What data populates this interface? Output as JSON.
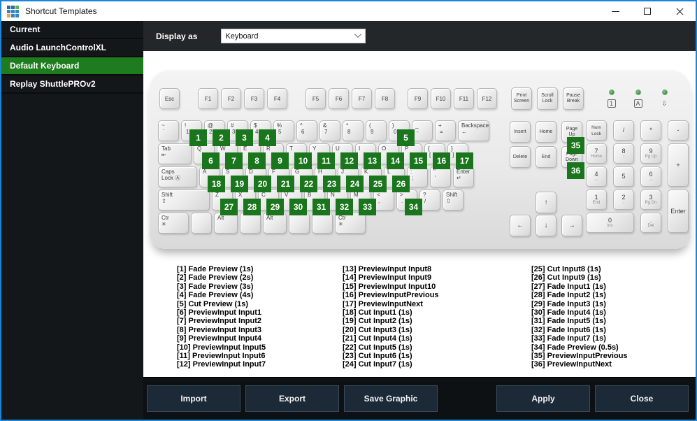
{
  "colors": {
    "accent_green": "#1e7c1f",
    "badge_green": "#1a761c",
    "window_border": "#1985dc"
  },
  "window": {
    "title": "Shortcut Templates",
    "icon_colors": [
      "#33689b",
      "#33689b",
      "#52b84d",
      "#2e86c8",
      "#2e86c8",
      "#2e86c8",
      "#f2a33c",
      "#2e86c8",
      "#2e86c8"
    ]
  },
  "sidebar": {
    "items": [
      {
        "label": "Current",
        "selected": false
      },
      {
        "label": "Audio LaunchControlXL",
        "selected": false
      },
      {
        "label": "Default Keyboard",
        "selected": true
      },
      {
        "label": "Replay ShuttlePROv2",
        "selected": false
      }
    ]
  },
  "toolbar": {
    "label": "Display as",
    "dropdown_value": "Keyboard"
  },
  "keyboard": {
    "esc": "Esc",
    "function_groups": [
      [
        "F1",
        "F2",
        "F3",
        "F4"
      ],
      [
        "F5",
        "F6",
        "F7",
        "F8"
      ],
      [
        "F9",
        "F10",
        "F11",
        "F12"
      ]
    ],
    "function_group_lefts": [
      70,
      224,
      370
    ],
    "system_keys": [
      {
        "label": "Print\nScreen",
        "name": "print-screen"
      },
      {
        "label": "Scroll\nLock",
        "name": "scroll-lock"
      },
      {
        "label": "Pause\nBreak",
        "name": "pause-break"
      }
    ],
    "leds": [
      {
        "name": "num-lock-led",
        "glyph": "1",
        "boxed": true
      },
      {
        "name": "caps-lock-led",
        "glyph": "A",
        "boxed": true
      },
      {
        "name": "scroll-lock-led",
        "glyph": "⇩",
        "boxed": false
      }
    ],
    "main_rows": [
      {
        "keys": [
          {
            "top": "~",
            "bottom": "`"
          },
          {
            "top": "!",
            "bottom": "1",
            "badge": "1"
          },
          {
            "top": "@",
            "bottom": "2",
            "badge": "2"
          },
          {
            "top": "#",
            "bottom": "3",
            "badge": "3"
          },
          {
            "top": "$",
            "bottom": "4",
            "badge": "4"
          },
          {
            "top": "%",
            "bottom": "5"
          },
          {
            "top": "^",
            "bottom": "6"
          },
          {
            "top": "&",
            "bottom": "7"
          },
          {
            "top": "*",
            "bottom": "8"
          },
          {
            "top": "(",
            "bottom": "9"
          },
          {
            "top": ")",
            "bottom": "0",
            "badge": "5"
          },
          {
            "top": "_",
            "bottom": "-"
          },
          {
            "top": "+",
            "bottom": "="
          },
          {
            "label": "Backspace\n      ←",
            "fill": true,
            "name": "backspace"
          }
        ]
      },
      {
        "keys": [
          {
            "label": "Tab\n⇤",
            "w": 48,
            "name": "tab"
          },
          {
            "label": "Q",
            "badge": "6"
          },
          {
            "label": "W",
            "badge": "7"
          },
          {
            "label": "E",
            "badge": "8"
          },
          {
            "label": "R",
            "badge": "9"
          },
          {
            "label": "T",
            "badge": "10"
          },
          {
            "label": "Y",
            "badge": "11"
          },
          {
            "label": "U",
            "badge": "12"
          },
          {
            "label": "I",
            "badge": "13"
          },
          {
            "label": "O",
            "badge": "14"
          },
          {
            "label": "P",
            "badge": "15"
          },
          {
            "top": "{",
            "bottom": "[",
            "badge": "16",
            "name": "bracket-left"
          },
          {
            "top": "}",
            "bottom": "]",
            "badge": "17",
            "name": "bracket-right"
          }
        ]
      },
      {
        "keys": [
          {
            "label": "Caps\nLock Ⓐ",
            "w": 56,
            "name": "caps-lock"
          },
          {
            "label": "A",
            "badge": "18"
          },
          {
            "label": "S",
            "badge": "19"
          },
          {
            "label": "D",
            "badge": "20"
          },
          {
            "label": "F",
            "badge": "21"
          },
          {
            "label": "G",
            "badge": "22"
          },
          {
            "label": "H",
            "badge": "23"
          },
          {
            "label": "J",
            "badge": "24"
          },
          {
            "label": "K",
            "badge": "25"
          },
          {
            "label": "L",
            "badge": "26"
          },
          {
            "top": ":",
            "bottom": ";",
            "name": "semicolon"
          },
          {
            "top": "\"",
            "bottom": "'",
            "name": "quote"
          },
          {
            "label": "Enter ↵",
            "fill": true,
            "name": "enter"
          }
        ]
      },
      {
        "keys": [
          {
            "label": "Shift\n⇧",
            "w": 74,
            "name": "shift-left"
          },
          {
            "label": "Z",
            "badge": "27"
          },
          {
            "label": "X",
            "badge": "28"
          },
          {
            "label": "C",
            "badge": "29"
          },
          {
            "label": "V",
            "badge": "30"
          },
          {
            "label": "B",
            "badge": "31"
          },
          {
            "label": "N",
            "badge": "32"
          },
          {
            "label": "M",
            "badge": "33"
          },
          {
            "top": "<",
            "bottom": ",",
            "name": "comma"
          },
          {
            "top": ">",
            "bottom": ".",
            "badge": "34",
            "name": "period"
          },
          {
            "top": "?",
            "bottom": "/",
            "name": "slash"
          },
          {
            "label": "Shift\n⇧",
            "fill": true,
            "name": "shift-right"
          }
        ]
      },
      {
        "keys": [
          {
            "label": "Ctr\n✳",
            "w": 44,
            "name": "ctrl-left"
          },
          {
            "label": "",
            "w": 30,
            "name": "blank-left"
          },
          {
            "label": "Alt",
            "w": 34,
            "name": "alt-left"
          },
          {
            "label": "",
            "fill": true,
            "name": "space"
          },
          {
            "label": "Alt",
            "w": 34,
            "name": "alt-right"
          },
          {
            "label": "",
            "w": 30,
            "name": "blank-right-1"
          },
          {
            "label": "",
            "w": 30,
            "name": "blank-right-2"
          },
          {
            "label": "Ctr\n✳",
            "w": 44,
            "name": "ctrl-right"
          }
        ]
      }
    ],
    "nav_rows": [
      [
        {
          "label": "Insert"
        },
        {
          "label": "Home"
        },
        {
          "label": "Page\nUp",
          "badge": "35",
          "name": "page-up"
        }
      ],
      [
        {
          "label": "Delete"
        },
        {
          "label": "End"
        },
        {
          "label": "Page\nDown",
          "badge": "36",
          "name": "page-down"
        }
      ]
    ],
    "arrow_up": "↑",
    "arrow_bottom": [
      "←",
      "↓",
      "→"
    ],
    "arrow_names": [
      "arrow-left",
      "arrow-down",
      "arrow-right"
    ],
    "numpad": [
      {
        "label": "Num\nLock",
        "c": 1,
        "r": 1,
        "name": "num-lock",
        "small": true
      },
      {
        "label": "/",
        "c": 2,
        "r": 1,
        "name": "numpad-divide"
      },
      {
        "label": "*",
        "c": 3,
        "r": 1,
        "name": "numpad-multiply"
      },
      {
        "label": "-",
        "c": 4,
        "r": 1,
        "name": "numpad-minus"
      },
      {
        "top": "7",
        "bottom": "Home",
        "c": 1,
        "r": 2,
        "name": "numpad-7"
      },
      {
        "top": "8",
        "bottom": "↑",
        "c": 2,
        "r": 2,
        "name": "numpad-8"
      },
      {
        "top": "9",
        "bottom": "Pg Up",
        "c": 3,
        "r": 2,
        "name": "numpad-9"
      },
      {
        "label": "+",
        "c": 4,
        "r": 2,
        "rs": 2,
        "name": "numpad-plus"
      },
      {
        "top": "4",
        "bottom": "←",
        "c": 1,
        "r": 3,
        "name": "numpad-4"
      },
      {
        "label": "5",
        "c": 2,
        "r": 3,
        "name": "numpad-5"
      },
      {
        "top": "6",
        "bottom": "→",
        "c": 3,
        "r": 3,
        "name": "numpad-6"
      },
      {
        "top": "1",
        "bottom": "End",
        "c": 1,
        "r": 4,
        "name": "numpad-1"
      },
      {
        "top": "2",
        "bottom": "↓",
        "c": 2,
        "r": 4,
        "name": "numpad-2"
      },
      {
        "top": "3",
        "bottom": "Pg Dn",
        "c": 3,
        "r": 4,
        "name": "numpad-3"
      },
      {
        "label": "Enter",
        "c": 4,
        "r": 4,
        "rs": 2,
        "name": "numpad-enter"
      },
      {
        "top": "0",
        "bottom": "Ins",
        "c": 1,
        "r": 5,
        "cs": 2,
        "name": "numpad-0"
      },
      {
        "top": ".",
        "bottom": "Del",
        "c": 3,
        "r": 5,
        "name": "numpad-dot"
      }
    ]
  },
  "shortcuts": {
    "columns": [
      [
        "[1] Fade Preview (1s)",
        "[2] Fade Preview (2s)",
        "[3] Fade Preview (3s)",
        "[4] Fade Preview (4s)",
        "[5] Cut Preview (1s)",
        "[6] PreviewInput Input1",
        "[7] PreviewInput Input2",
        "[8] PreviewInput Input3",
        "[9] PreviewInput Input4",
        "[10] PreviewInput Input5",
        "[11] PreviewInput Input6",
        "[12] PreviewInput Input7"
      ],
      [
        "[13] PreviewInput Input8",
        "[14] PreviewInput Input9",
        "[15] PreviewInput Input10",
        "[16] PreviewInputPrevious",
        "[17] PreviewInputNext",
        "[18] Cut Input1 (1s)",
        "[19] Cut Input2 (1s)",
        "[20] Cut Input3 (1s)",
        "[21] Cut Input4 (1s)",
        "[22] Cut Input5 (1s)",
        "[23] Cut Input6 (1s)",
        "[24] Cut Input7 (1s)"
      ],
      [
        "[25] Cut Input8 (1s)",
        "[26] Cut Input9 (1s)",
        "[27] Fade Input1 (1s)",
        "[28] Fade Input2 (1s)",
        "[29] Fade Input3 (1s)",
        "[30] Fade Input4 (1s)",
        "[31] Fade Input5 (1s)",
        "[32] Fade Input6 (1s)",
        "[33] Fade Input7 (1s)",
        "[34] Fade Preview (0.5s)",
        "[35] PreviewInputPrevious",
        "[36] PreviewInputNext"
      ]
    ]
  },
  "footer": {
    "left_buttons": [
      "Import",
      "Export",
      "Save Graphic"
    ],
    "right_buttons": [
      "Apply",
      "Close"
    ]
  }
}
